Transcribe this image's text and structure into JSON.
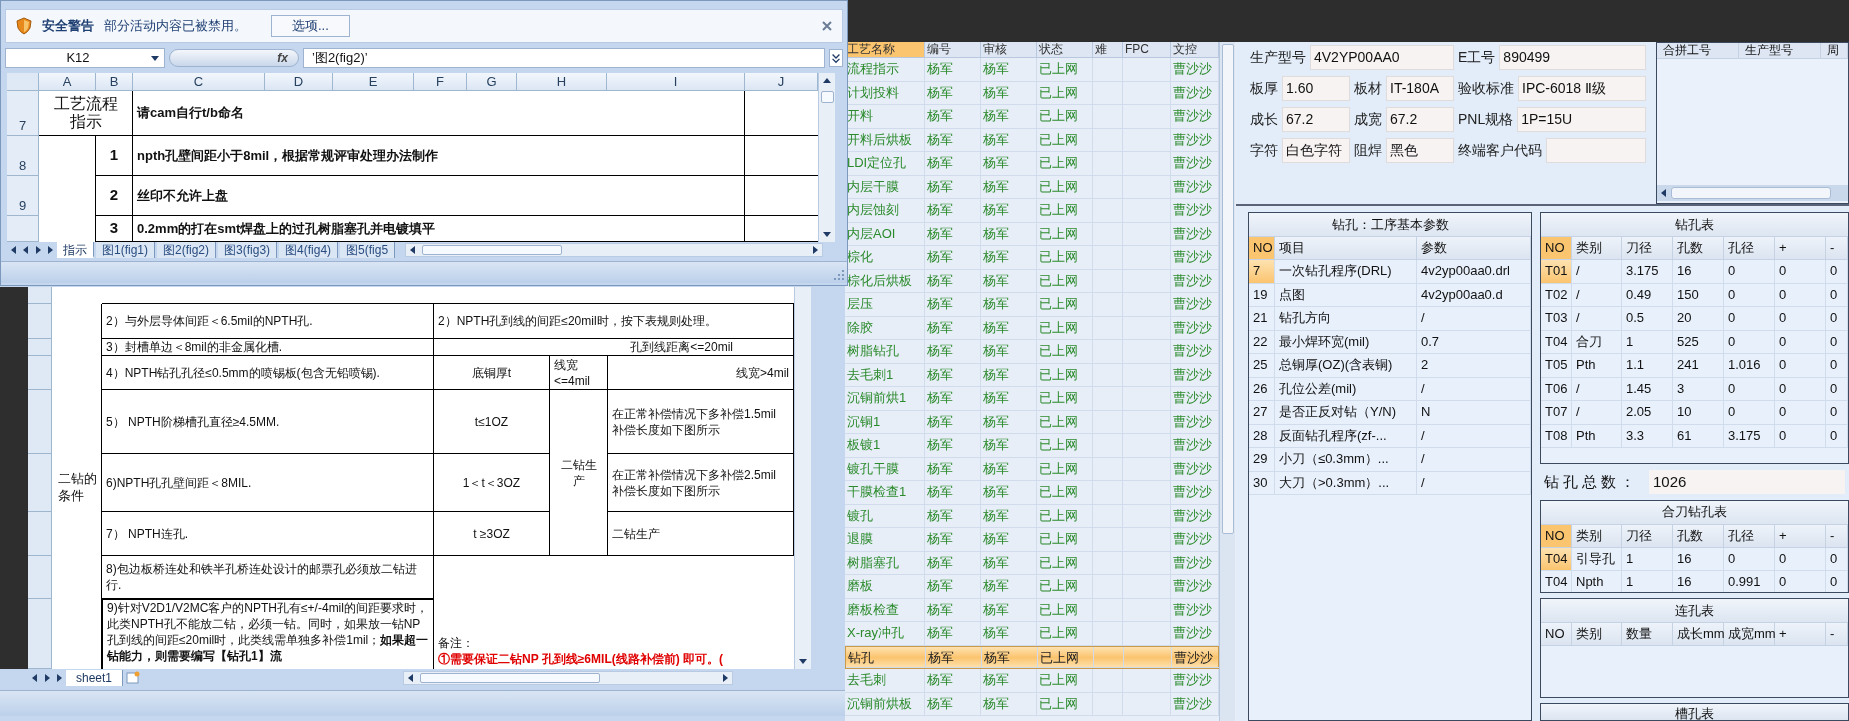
{
  "front_window": {
    "security_bar": {
      "title": "安全警告",
      "message": "部分活动内容已被禁用。",
      "button": "选项..."
    },
    "name_box": "K12",
    "function_label": "fx",
    "formula": "’图2(fig2)’",
    "columns": [
      "A",
      "B",
      "C",
      "D",
      "E",
      "F",
      "G",
      "H",
      "I",
      "J"
    ],
    "rows": [
      {
        "kind": "heading",
        "number": "7",
        "label": "工艺流程指示",
        "text": "请cam自行t/b命名"
      },
      {
        "kind": "item",
        "number": "8",
        "index": "1",
        "text": "npth孔壁间距小于8mil，根据常规评审处理办法制作"
      },
      {
        "kind": "item",
        "number": "9",
        "index": "2",
        "text": "丝印不允许上盘"
      },
      {
        "kind": "item",
        "index": "3",
        "text": "0.2mm的打在smt焊盘上的过孔树脂塞孔并电镀填平"
      }
    ],
    "sheet_tabs": [
      {
        "label": "指示",
        "selected": true
      },
      {
        "label": "图1(fig1)",
        "selected": false
      },
      {
        "label": "图2(fig2)",
        "selected": false
      },
      {
        "label": "图3(fig3)",
        "selected": false
      },
      {
        "label": "图4(fig4)",
        "selected": false
      },
      {
        "label": "图5(fig5",
        "selected": false
      }
    ]
  },
  "back_window": {
    "section_label": "二钻的条件",
    "conditions": [
      "2）与外层导体间距＜6.5mil的NPTH孔.",
      "3）封槽单边＜8mil的非金属化槽.",
      "4）NPTH钻孔孔径≤0.5mm的喷锡板(包含无铅喷锡).",
      "5） NPTH阶梯槽孔直径≥4.5MM.",
      "6)NPTH孔孔壁间距＜8MIL.",
      "7） NPTH连孔.",
      "8)包边板桥连处和铁半孔桥连处设计的邮票孔必须放二钻进行.",
      "9)针对V2D1/V2MC客户的NPTH孔有≤+/-4mil的间距要求时，此类NPTH孔不能放二钻，必须一钻。同时，如果放一钻NP孔到线的间距≤20mil时，此类线需单独多补偿1mil；**如果超一钻能力，则需要编写【钻孔1】流**"
    ],
    "rule_note": "2）NPTH孔到线的间距≤20mil时，按下表规则处理。",
    "distance_header": "孔到线距离<=20mil",
    "table_headers": [
      "底铜厚t",
      "线宽\n<=4mil",
      "线宽>4mil"
    ],
    "thicknesses": [
      "t≤1OZ",
      "1＜t＜3OZ",
      "t  ≥3OZ"
    ],
    "merged_result": "二钻生产",
    "results": [
      "在正常补偿情况下多补偿1.5mil\n补偿长度如下图所示",
      "在正常补偿情况下多补偿2.5mil\n补偿长度如下图所示",
      "二钻生产"
    ],
    "remark_label": "备注：",
    "remarks": [
      "①需要保证二钻NP 孔到线≥6MIL(线路补偿前) 即可。("
    ],
    "sheet_tabs": [
      {
        "label": "sheet1",
        "selected": true
      }
    ]
  },
  "process_list": {
    "columns": [
      {
        "label": "工艺名称",
        "sorted": true
      },
      {
        "label": "编号",
        "sorted": false
      },
      {
        "label": "审核",
        "sorted": false
      },
      {
        "label": "状态",
        "sorted": false
      },
      {
        "label": "难",
        "sorted": false
      },
      {
        "label": "FPC",
        "sorted": false
      },
      {
        "label": "文控",
        "sorted": false
      }
    ],
    "rows": [
      {
        "name": "流程指示",
        "code": "杨军",
        "reviewer": "杨军",
        "status": "已上网",
        "doc_control": "曹沙沙",
        "selected": false
      },
      {
        "name": "计划投料",
        "code": "杨军",
        "reviewer": "杨军",
        "status": "已上网",
        "doc_control": "曹沙沙",
        "selected": false
      },
      {
        "name": "开料",
        "code": "杨军",
        "reviewer": "杨军",
        "status": "已上网",
        "doc_control": "曹沙沙",
        "selected": false
      },
      {
        "name": "开料后烘板",
        "code": "杨军",
        "reviewer": "杨军",
        "status": "已上网",
        "doc_control": "曹沙沙",
        "selected": false
      },
      {
        "name": "LDI定位孔",
        "code": "杨军",
        "reviewer": "杨军",
        "status": "已上网",
        "doc_control": "曹沙沙",
        "selected": false
      },
      {
        "name": "内层干膜",
        "code": "杨军",
        "reviewer": "杨军",
        "status": "已上网",
        "doc_control": "曹沙沙",
        "selected": false
      },
      {
        "name": "内层蚀刻",
        "code": "杨军",
        "reviewer": "杨军",
        "status": "已上网",
        "doc_control": "曹沙沙",
        "selected": false
      },
      {
        "name": "内层AOI",
        "code": "杨军",
        "reviewer": "杨军",
        "status": "已上网",
        "doc_control": "曹沙沙",
        "selected": false
      },
      {
        "name": "棕化",
        "code": "杨军",
        "reviewer": "杨军",
        "status": "已上网",
        "doc_control": "曹沙沙",
        "selected": false
      },
      {
        "name": "棕化后烘板",
        "code": "杨军",
        "reviewer": "杨军",
        "status": "已上网",
        "doc_control": "曹沙沙",
        "selected": false
      },
      {
        "name": "层压",
        "code": "杨军",
        "reviewer": "杨军",
        "status": "已上网",
        "doc_control": "曹沙沙",
        "selected": false
      },
      {
        "name": "除胶",
        "code": "杨军",
        "reviewer": "杨军",
        "status": "已上网",
        "doc_control": "曹沙沙",
        "selected": false
      },
      {
        "name": "树脂钻孔",
        "code": "杨军",
        "reviewer": "杨军",
        "status": "已上网",
        "doc_control": "曹沙沙",
        "selected": false
      },
      {
        "name": "去毛刺1",
        "code": "杨军",
        "reviewer": "杨军",
        "status": "已上网",
        "doc_control": "曹沙沙",
        "selected": false
      },
      {
        "name": "沉铜前烘1",
        "code": "杨军",
        "reviewer": "杨军",
        "status": "已上网",
        "doc_control": "曹沙沙",
        "selected": false
      },
      {
        "name": "沉铜1",
        "code": "杨军",
        "reviewer": "杨军",
        "status": "已上网",
        "doc_control": "曹沙沙",
        "selected": false
      },
      {
        "name": "板镀1",
        "code": "杨军",
        "reviewer": "杨军",
        "status": "已上网",
        "doc_control": "曹沙沙",
        "selected": false
      },
      {
        "name": "镀孔干膜",
        "code": "杨军",
        "reviewer": "杨军",
        "status": "已上网",
        "doc_control": "曹沙沙",
        "selected": false
      },
      {
        "name": "干膜检查1",
        "code": "杨军",
        "reviewer": "杨军",
        "status": "已上网",
        "doc_control": "曹沙沙",
        "selected": false
      },
      {
        "name": "镀孔",
        "code": "杨军",
        "reviewer": "杨军",
        "status": "已上网",
        "doc_control": "曹沙沙",
        "selected": false
      },
      {
        "name": "退膜",
        "code": "杨军",
        "reviewer": "杨军",
        "status": "已上网",
        "doc_control": "曹沙沙",
        "selected": false
      },
      {
        "name": "树脂塞孔",
        "code": "杨军",
        "reviewer": "杨军",
        "status": "已上网",
        "doc_control": "曹沙沙",
        "selected": false
      },
      {
        "name": "磨板",
        "code": "杨军",
        "reviewer": "杨军",
        "status": "已上网",
        "doc_control": "曹沙沙",
        "selected": false
      },
      {
        "name": "磨板检查",
        "code": "杨军",
        "reviewer": "杨军",
        "status": "已上网",
        "doc_control": "曹沙沙",
        "selected": false
      },
      {
        "name": "X-ray冲孔",
        "code": "杨军",
        "reviewer": "杨军",
        "status": "已上网",
        "doc_control": "曹沙沙",
        "selected": false
      },
      {
        "name": "钻孔",
        "code": "杨军",
        "reviewer": "杨军",
        "status": "已上网",
        "doc_control": "曹沙沙",
        "selected": true
      },
      {
        "name": "去毛刺",
        "code": "杨军",
        "reviewer": "杨军",
        "status": "已上网",
        "doc_control": "曹沙沙",
        "selected": false
      },
      {
        "name": "沉铜前烘板",
        "code": "杨军",
        "reviewer": "杨军",
        "status": "已上网",
        "doc_control": "曹沙沙",
        "selected": false
      }
    ]
  },
  "info": {
    "header_fields": [
      {
        "label": "生产型号",
        "value": "4V2YP00AA0"
      },
      {
        "label": "E工号",
        "value": "890499"
      }
    ],
    "rows": [
      [
        {
          "label": "板厚",
          "value": "1.60"
        },
        {
          "label": "板材",
          "value": "IT-180A"
        },
        {
          "label": "验收标准",
          "value": "IPC-6018 Ⅱ级"
        }
      ],
      [
        {
          "label": "成长",
          "value": "67.2"
        },
        {
          "label": "成宽",
          "value": "67.2"
        },
        {
          "label": "PNL规格",
          "value": "1P=15U"
        }
      ],
      [
        {
          "label": "字符",
          "value": "白色字符"
        },
        {
          "label": "阻焊",
          "value": "黑色"
        },
        {
          "label": "终端客户代码"
        }
      ]
    ]
  },
  "combined_table": {
    "columns": [
      "合拼工号",
      "生产型号",
      "周"
    ]
  },
  "params_panel": {
    "title": "钻孔：工序基本参数",
    "columns": [
      "NO",
      "项目",
      "参数"
    ],
    "rows": [
      {
        "cells": [
          "7",
          "一次钻孔程序(DRL)",
          "4v2yp00aa0.drl"
        ],
        "selected": true
      },
      {
        "cells": [
          "19",
          "点图",
          "4v2yp00aa0.d"
        ],
        "selected": false
      },
      {
        "cells": [
          "21",
          "钻孔方向",
          "/"
        ],
        "selected": false
      },
      {
        "cells": [
          "22",
          "最小焊环宽(mil)",
          "0.7"
        ],
        "selected": false
      },
      {
        "cells": [
          "25",
          "总铜厚(OZ)(含表铜)",
          "2"
        ],
        "selected": false
      },
      {
        "cells": [
          "26",
          "孔位公差(mil)",
          "/"
        ],
        "selected": false
      },
      {
        "cells": [
          "27",
          "是否正反对钻（Y/N)",
          "N"
        ],
        "selected": false
      },
      {
        "cells": [
          "28",
          "反面钻孔程序(zf-...",
          "/"
        ],
        "selected": false
      },
      {
        "cells": [
          "29",
          "小刀（≤0.3mm）...",
          "/"
        ],
        "selected": false
      },
      {
        "cells": [
          "30",
          "大刀（>0.3mm）...",
          "/"
        ],
        "selected": false
      }
    ]
  },
  "drill_table": {
    "title": "钻孔表",
    "columns": [
      "NO",
      "类别",
      "刀径",
      "孔数",
      "孔径",
      "+",
      "-"
    ],
    "rows": [
      {
        "cells": [
          "T01",
          "/",
          "3.175",
          "16",
          "0",
          "0",
          "0"
        ],
        "selected": true
      },
      {
        "cells": [
          "T02",
          "/",
          "0.49",
          "150",
          "0",
          "0",
          "0"
        ],
        "selected": false
      },
      {
        "cells": [
          "T03",
          "/",
          "0.5",
          "20",
          "0",
          "0",
          "0"
        ],
        "selected": false
      },
      {
        "cells": [
          "T04",
          "合刀",
          "1",
          "525",
          "0",
          "0",
          "0"
        ],
        "selected": false
      },
      {
        "cells": [
          "T05",
          "Pth",
          "1.1",
          "241",
          "1.016",
          "0",
          "0"
        ],
        "selected": false
      },
      {
        "cells": [
          "T06",
          "/",
          "1.45",
          "3",
          "0",
          "0",
          "0"
        ],
        "selected": false
      },
      {
        "cells": [
          "T07",
          "/",
          "2.05",
          "10",
          "0",
          "0",
          "0"
        ],
        "selected": false
      },
      {
        "cells": [
          "T08",
          "Pth",
          "3.3",
          "61",
          "3.175",
          "0",
          "0"
        ],
        "selected": false
      }
    ]
  },
  "drill_total": {
    "label": "钻孔总数：",
    "value": "1026"
  },
  "combined_drill_table": {
    "title": "合刀钻孔表",
    "columns": [
      "NO",
      "类别",
      "刀径",
      "孔数",
      "孔径",
      "+",
      "-"
    ],
    "rows": [
      {
        "cells": [
          "T04",
          "引导孔",
          "1",
          "16",
          "0",
          "0",
          "0"
        ],
        "selected": true
      },
      {
        "cells": [
          "T04",
          "Npth",
          "1",
          "16",
          "0.991",
          "0",
          "0"
        ],
        "selected": false
      }
    ]
  },
  "link_hole_table": {
    "title": "连孔表",
    "columns": [
      "NO",
      "类别",
      "数量",
      "成长mm",
      "成宽mm",
      "+",
      "-"
    ]
  },
  "slot_table": {
    "title": "槽孔表"
  }
}
